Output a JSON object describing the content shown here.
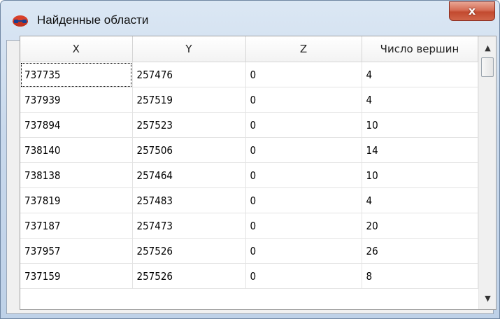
{
  "window": {
    "title": "Найденные области",
    "close_label": "x"
  },
  "toolbar": {
    "buttons": [
      {
        "icon": "export-to-layer-icon"
      },
      {
        "icon": "select-area-icon"
      }
    ]
  },
  "table": {
    "columns": [
      "X",
      "Y",
      "Z",
      "Число вершин"
    ],
    "rows": [
      [
        "737735",
        "257476",
        "0",
        "4"
      ],
      [
        "737939",
        "257519",
        "0",
        "4"
      ],
      [
        "737894",
        "257523",
        "0",
        "10"
      ],
      [
        "738140",
        "257506",
        "0",
        "14"
      ],
      [
        "738138",
        "257464",
        "0",
        "10"
      ],
      [
        "737819",
        "257483",
        "0",
        "4"
      ],
      [
        "737187",
        "257473",
        "0",
        "20"
      ],
      [
        "737957",
        "257526",
        "0",
        "26"
      ],
      [
        "737159",
        "257526",
        "0",
        "8"
      ]
    ]
  },
  "scrollbar": {
    "up_arrow": "▲",
    "down_arrow": "▼"
  },
  "colors": {
    "title_bar": "#c9d9ec",
    "close_button": "#c95a40",
    "select_icon": "#5fcfe0"
  }
}
